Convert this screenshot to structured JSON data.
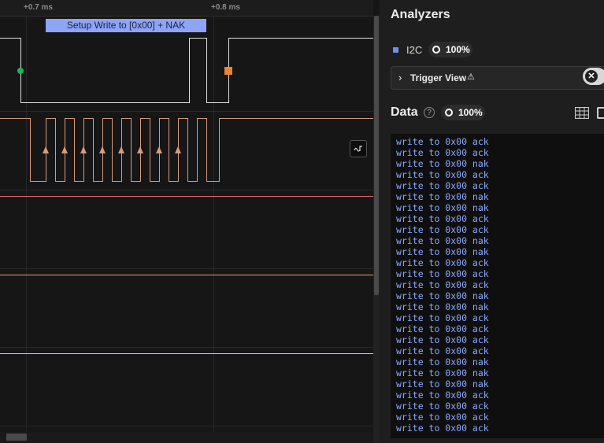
{
  "waveform": {
    "time_labels": [
      "+0.7 ms",
      "+0.8 ms"
    ],
    "frame_label": "Setup Write to [0x00] + NAK",
    "mode_button_icon": "signal-mode-icon",
    "colors": {
      "sda": "#e0e0e0",
      "scl": "#d79b7d",
      "start_marker": "#1fb55c",
      "stop_marker": "#f08232",
      "channel3": "#e86d6d",
      "channel4": "#e6a07a",
      "channel5": "#e8d778",
      "channel6": "#5fd16f"
    }
  },
  "panel": {
    "title": "Analyzers",
    "analyzer": {
      "name": "I2C",
      "percent": "100%",
      "color": "#6f8ff0"
    },
    "trigger": {
      "label": "Trigger View",
      "warning_icon": "⚠",
      "clear_icon": "close-icon"
    },
    "data": {
      "title": "Data",
      "help": "?",
      "percent": "100%"
    },
    "rows": [
      "write to 0x00 ack",
      "write to 0x00 ack",
      "write to 0x00 nak",
      "write to 0x00 ack",
      "write to 0x00 ack",
      "write to 0x00 nak",
      "write to 0x00 nak",
      "write to 0x00 ack",
      "write to 0x00 ack",
      "write to 0x00 nak",
      "write to 0x00 nak",
      "write to 0x00 ack",
      "write to 0x00 ack",
      "write to 0x00 ack",
      "write to 0x00 nak",
      "write to 0x00 nak",
      "write to 0x00 ack",
      "write to 0x00 ack",
      "write to 0x00 ack",
      "write to 0x00 ack",
      "write to 0x00 nak",
      "write to 0x00 nak",
      "write to 0x00 nak",
      "write to 0x00 ack",
      "write to 0x00 ack",
      "write to 0x00 ack",
      "write to 0x00 ack"
    ]
  }
}
